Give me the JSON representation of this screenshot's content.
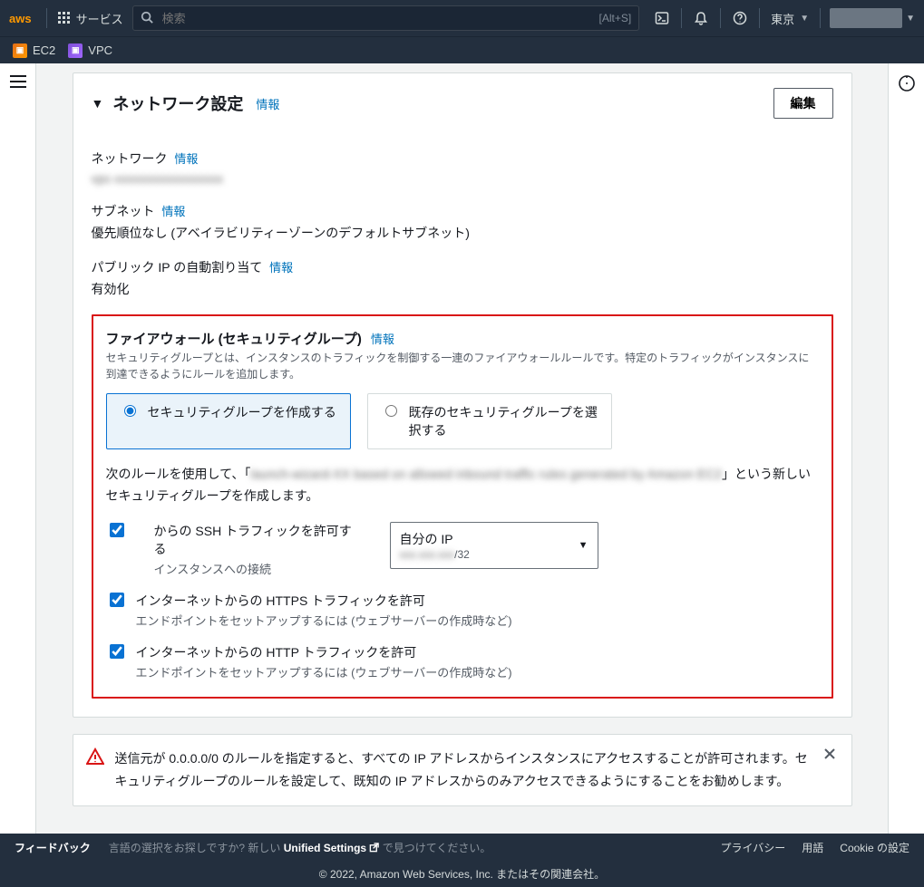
{
  "header": {
    "services": "サービス",
    "search_placeholder": "検索",
    "shortcut": "[Alt+S]",
    "region": "東京"
  },
  "subnav": {
    "ec2": "EC2",
    "vpc": "VPC"
  },
  "card": {
    "title": "ネットワーク設定",
    "info": "情報",
    "edit": "編集",
    "network": {
      "label": "ネットワーク",
      "value": "vpc-xxxxxxxxxxxxxxxxx"
    },
    "subnet": {
      "label": "サブネット",
      "value": "優先順位なし (アベイラビリティーゾーンのデフォルトサブネット)"
    },
    "publicip": {
      "label": "パブリック IP の自動割り当て",
      "value": "有効化"
    }
  },
  "firewall": {
    "title": "ファイアウォール (セキュリティグループ)",
    "info": "情報",
    "desc": "セキュリティグループとは、インスタンスのトラフィックを制御する一連のファイアウォールルールです。特定のトラフィックがインスタンスに到達できるようにルールを追加します。",
    "create_opt": "セキュリティグループを作成する",
    "select_opt": "既存のセキュリティグループを選択する",
    "newgroup_pre": "次のルールを使用して、「",
    "newgroup_mid_blur": "launch-wizard-XX based on allowed inbound traffic rules generated by Amazon EC2",
    "newgroup_post": "」という新しいセキュリティグループを作成します。",
    "ssh": {
      "label": "からの SSH トラフィックを許可する",
      "desc": "インスタンスへの接続",
      "select_label": "自分の IP",
      "select_cidr_suffix": "/32",
      "select_cidr_blur": "xxx.xxx.xxx"
    },
    "https": {
      "label": "インターネットからの HTTPS トラフィックを許可",
      "desc": "エンドポイントをセットアップするには (ウェブサーバーの作成時など)"
    },
    "http": {
      "label": "インターネットからの HTTP トラフィックを許可",
      "desc": "エンドポイントをセットアップするには (ウェブサーバーの作成時など)"
    }
  },
  "warn": {
    "text": "送信元が 0.0.0.0/0 のルールを指定すると、すべての IP アドレスからインスタンスにアクセスすることが許可されます。セキュリティグループのルールを設定して、既知の IP アドレスからのみアクセスできるようにすることをお勧めします。"
  },
  "footer": {
    "feedback": "フィードバック",
    "lang_q": "言語の選択をお探しですか? 新しい ",
    "unified": "Unified Settings",
    "lang_tail": " で見つけてください。",
    "privacy": "プライバシー",
    "terms": "用語",
    "cookie": "Cookie の設定",
    "copyright": "© 2022, Amazon Web Services, Inc. またはその関連会社。"
  }
}
